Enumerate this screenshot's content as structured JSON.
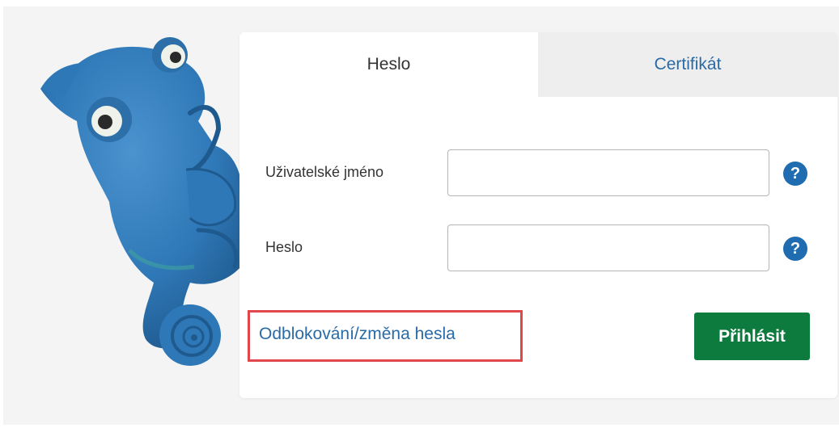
{
  "tabs": {
    "password_tab": "Heslo",
    "certificate_tab": "Certifikát"
  },
  "form": {
    "username_label": "Uživatelské jméno",
    "username_value": "",
    "password_label": "Heslo",
    "password_value": "",
    "help_glyph": "?"
  },
  "actions": {
    "unlock_link": "Odblokování/změna hesla",
    "login_button": "Přihlásit"
  },
  "colors": {
    "link_blue": "#2a6aa6",
    "help_blue": "#1f6cb0",
    "login_green": "#0d7a3e",
    "highlight_red": "#e0474c",
    "mascot_blue": "#2f78b7"
  },
  "icons": {
    "mascot": "chameleon-mascot",
    "help": "question-circle-icon"
  }
}
